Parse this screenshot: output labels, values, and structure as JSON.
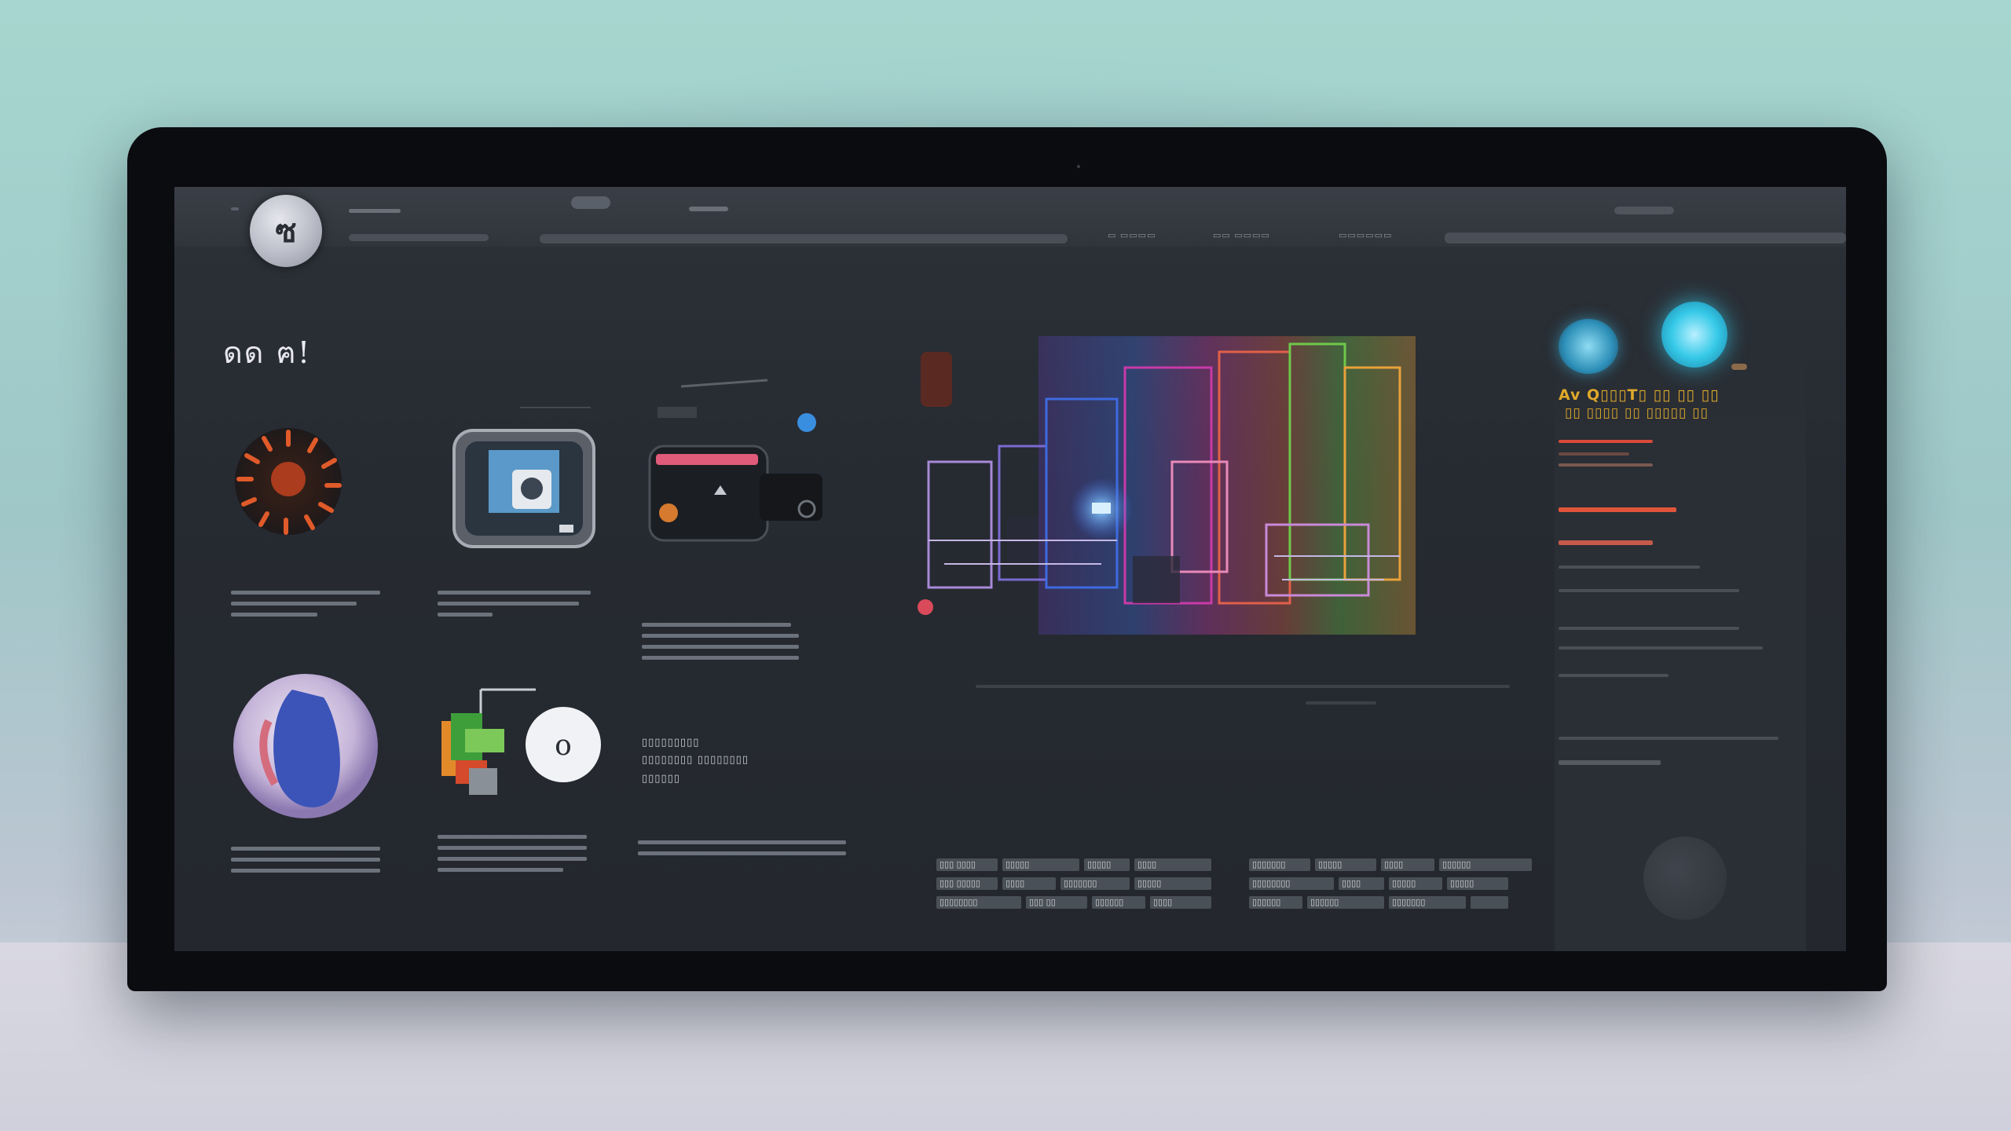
{
  "page": {
    "heading": "ดด ฅ!"
  },
  "topbar": {
    "logo_glyph": "ซ",
    "nav": [
      {
        "label": "▭ ▭▭▭▭"
      },
      {
        "label": "▭▭ ▭▭▭▭"
      },
      {
        "label": "▭▭▭▭▭▭"
      }
    ]
  },
  "gallery": {
    "items": [
      {
        "name": "radial-art"
      },
      {
        "name": "tv-device"
      },
      {
        "name": "camera-device"
      },
      {
        "name": "planet-portrait"
      },
      {
        "name": "robot-bubble"
      }
    ],
    "caption_card": {
      "line1": "▯▯▯▯▯▯▯▯▯",
      "line2": "▯▯▯▯▯▯▯▯ ▯▯▯▯▯▯▯▯",
      "line3": "▯▯▯▯▯▯"
    }
  },
  "right_panel": {
    "promo_line1": "Av Q▯▯▯T▯ ▯▯ ▯▯ ▯▯",
    "promo_line2": "▯▯ ▯▯▯▯ ▯▯ ▯▯▯▯▯ ▯▯"
  },
  "colors": {
    "accent_cyan": "#35c9e8",
    "accent_amber": "#e0a92a",
    "accent_red": "#d94a3a",
    "screen_bg": "#262a31"
  },
  "tables": [
    {
      "rows": [
        [
          "▯▯▯ ▯▯▯▯",
          "▯▯▯▯▯",
          "▯▯▯▯▯",
          "▯▯▯▯"
        ],
        [
          "▯▯▯ ▯▯▯▯▯",
          "▯▯▯▯",
          "▯▯▯▯▯▯▯",
          "▯▯▯▯▯"
        ],
        [
          "▯▯▯▯▯▯▯▯",
          "▯▯▯ ▯▯",
          "▯▯▯▯▯▯",
          "▯▯▯▯"
        ]
      ]
    },
    {
      "rows": [
        [
          "▯▯▯▯▯▯▯",
          "▯▯▯▯▯",
          "▯▯▯▯",
          "▯▯▯▯▯▯"
        ],
        [
          "▯▯▯▯▯▯▯▯",
          "▯▯▯▯",
          "▯▯▯▯▯",
          "▯▯▯▯▯"
        ],
        [
          "▯▯▯▯▯▯",
          "▯▯▯▯▯▯",
          "▯▯▯▯▯▯▯",
          ""
        ]
      ]
    }
  ]
}
